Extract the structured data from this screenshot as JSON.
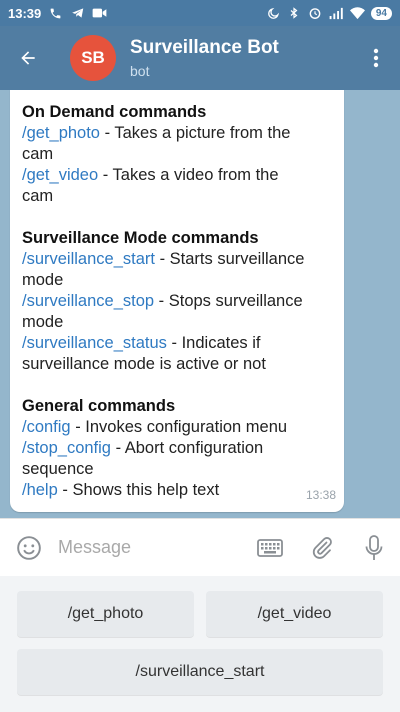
{
  "status_bar": {
    "time": "13:39",
    "battery": "94"
  },
  "header": {
    "avatar_initials": "SB",
    "title": "Surveillance Bot",
    "subtitle": "bot"
  },
  "message": {
    "lines": [
      [
        {
          "t": "On Demand commands",
          "k": "heading"
        }
      ],
      [
        {
          "t": "/get_photo",
          "k": "cmd"
        },
        {
          "t": " - Takes a picture from the",
          "k": "text"
        }
      ],
      [
        {
          "t": "cam",
          "k": "text"
        }
      ],
      [
        {
          "t": "/get_video",
          "k": "cmd"
        },
        {
          "t": " - Takes a video from the",
          "k": "text"
        }
      ],
      [
        {
          "t": "cam",
          "k": "text"
        }
      ],
      [],
      [
        {
          "t": "Surveillance Mode commands",
          "k": "heading"
        }
      ],
      [
        {
          "t": "/surveillance_start",
          "k": "cmd"
        },
        {
          "t": " - Starts surveillance",
          "k": "text"
        }
      ],
      [
        {
          "t": "mode",
          "k": "text"
        }
      ],
      [
        {
          "t": "/surveillance_stop",
          "k": "cmd"
        },
        {
          "t": " - Stops surveillance",
          "k": "text"
        }
      ],
      [
        {
          "t": "mode",
          "k": "text"
        }
      ],
      [
        {
          "t": "/surveillance_status",
          "k": "cmd"
        },
        {
          "t": " - Indicates if",
          "k": "text"
        }
      ],
      [
        {
          "t": "surveillance mode is active or not",
          "k": "text"
        }
      ],
      [],
      [
        {
          "t": "General commands",
          "k": "heading"
        }
      ],
      [
        {
          "t": "/config",
          "k": "cmd"
        },
        {
          "t": " - Invokes configuration menu",
          "k": "text"
        }
      ],
      [
        {
          "t": "/stop_config",
          "k": "cmd"
        },
        {
          "t": " - Abort configuration",
          "k": "text"
        }
      ],
      [
        {
          "t": "sequence",
          "k": "text"
        }
      ],
      [
        {
          "t": "/help",
          "k": "cmd"
        },
        {
          "t": " - Shows this help text",
          "k": "text"
        }
      ]
    ],
    "time": "13:38"
  },
  "input": {
    "placeholder": "Message"
  },
  "keyboard": {
    "rows": [
      [
        "/get_photo",
        "/get_video"
      ],
      [
        "/surveillance_start"
      ]
    ]
  },
  "colors": {
    "header_bg": "#517da2",
    "link": "#2f7ac2",
    "avatar_bg": "#e6533c"
  }
}
